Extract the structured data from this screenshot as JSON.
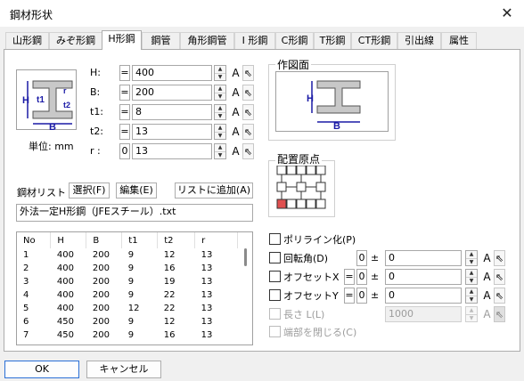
{
  "window": {
    "title": "鋼材形状",
    "close_glyph": "✕"
  },
  "tabs": [
    "山形鋼",
    "みぞ形鋼",
    "H形鋼",
    "鋼管",
    "角形鋼管",
    "I 形鋼",
    "C形鋼",
    "T形鋼",
    "CT形鋼",
    "引出線",
    "属性"
  ],
  "section_icon": {
    "labels": {
      "H": "H",
      "t1": "t1",
      "r": "r",
      "t2": "t2",
      "B": "B"
    },
    "unit_label": "単位: mm"
  },
  "params": [
    {
      "label": "H:",
      "op": "=",
      "value": "400",
      "a": "A"
    },
    {
      "label": "B:",
      "op": "=",
      "value": "200",
      "a": "A"
    },
    {
      "label": "t1:",
      "op": "=",
      "value": "8",
      "a": "A"
    },
    {
      "label": "t2:",
      "op": "=",
      "value": "13",
      "a": "A"
    },
    {
      "label": "r :",
      "op": "0",
      "value": "13",
      "a": "A"
    }
  ],
  "drawing_group": {
    "title": "作図面",
    "labels": {
      "H": "H",
      "B": "B"
    }
  },
  "origin_group": {
    "title": "配置原点"
  },
  "list_section": {
    "label": "鋼材リスト",
    "select_btn": "選択(F)",
    "edit_btn": "編集(E)",
    "add_btn": "リストに追加(A)",
    "file": "外法一定H形鋼（JFEスチール）.txt",
    "columns": [
      "No",
      "H",
      "B",
      "t1",
      "t2",
      "r"
    ],
    "rows": [
      [
        "1",
        "400",
        "200",
        "9",
        "12",
        "13"
      ],
      [
        "2",
        "400",
        "200",
        "9",
        "16",
        "13"
      ],
      [
        "3",
        "400",
        "200",
        "9",
        "19",
        "13"
      ],
      [
        "4",
        "400",
        "200",
        "9",
        "22",
        "13"
      ],
      [
        "5",
        "400",
        "200",
        "12",
        "22",
        "13"
      ],
      [
        "6",
        "450",
        "200",
        "9",
        "12",
        "13"
      ],
      [
        "7",
        "450",
        "200",
        "9",
        "16",
        "13"
      ]
    ]
  },
  "options": {
    "polyline": "ポリライン化(P)",
    "rotation": {
      "label": "回転角(D)",
      "pre": "0",
      "pm": "±",
      "value": "0",
      "a": "A"
    },
    "offset_x": {
      "label": "オフセットX",
      "eq": "=",
      "pre": "0",
      "pm": "±",
      "value": "0",
      "a": "A"
    },
    "offset_y": {
      "label": "オフセットY",
      "eq": "=",
      "pre": "0",
      "pm": "±",
      "value": "0",
      "a": "A"
    },
    "length": {
      "label": "長さ L(L)",
      "value": "1000",
      "a": "A"
    },
    "close_ends": "端部を閉じる(C)"
  },
  "footer": {
    "ok": "OK",
    "cancel": "キャンセル"
  },
  "colors": {
    "dim_blue": "#1a1aa6",
    "steel_gray": "#c8c8c8",
    "origin_red": "#e05050"
  }
}
